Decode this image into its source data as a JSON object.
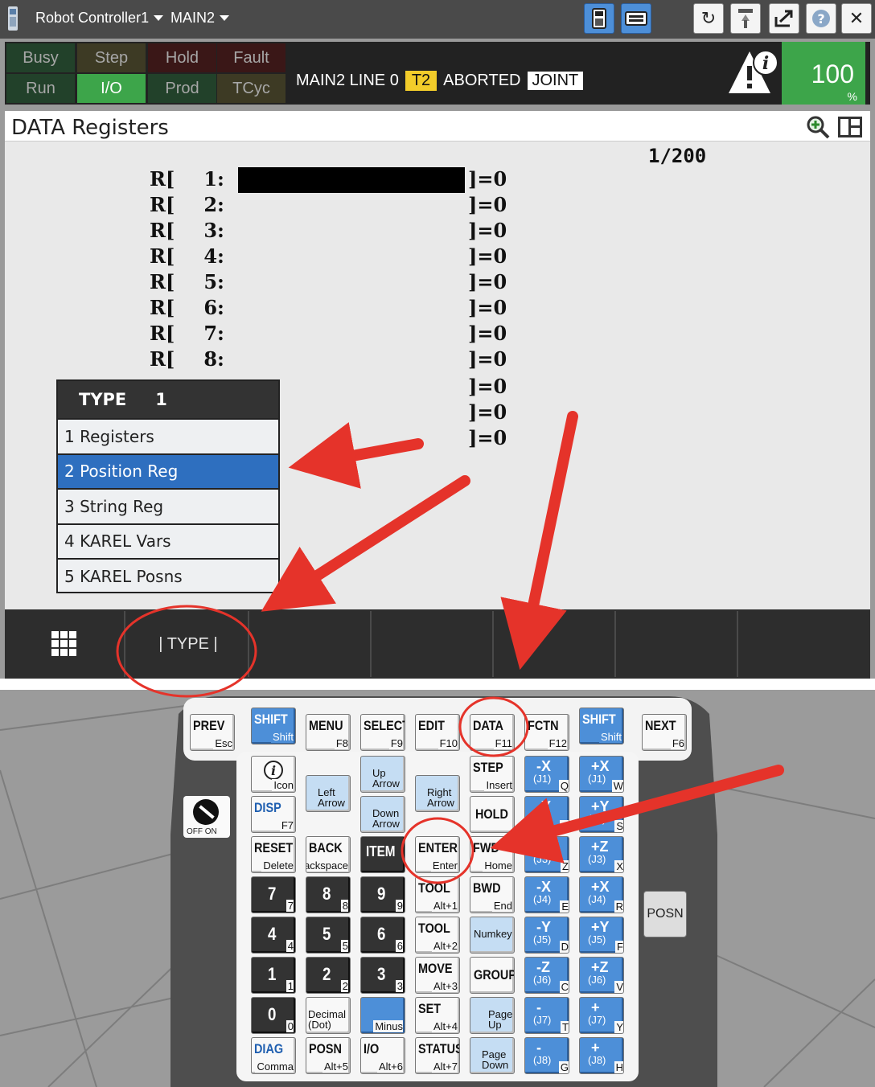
{
  "titlebar": {
    "controller": "Robot Controller1",
    "program": "MAIN2"
  },
  "status": {
    "buttons": [
      {
        "label": "Busy",
        "state": "off",
        "color": "#22412a"
      },
      {
        "label": "Step",
        "state": "off",
        "color": "#3d3a24"
      },
      {
        "label": "Hold",
        "state": "off",
        "color": "#3a1717"
      },
      {
        "label": "Fault",
        "state": "off",
        "color": "#3a1717"
      },
      {
        "label": "Run",
        "state": "off",
        "color": "#22412a"
      },
      {
        "label": "I/O",
        "state": "on",
        "color": "#3da54a"
      },
      {
        "label": "Prod",
        "state": "off",
        "color": "#22412a"
      },
      {
        "label": "TCyc",
        "state": "off",
        "color": "#3d3a24"
      }
    ],
    "line_text": "MAIN2 LINE 0",
    "mode_tag": "T2",
    "state_text": "ABORTED",
    "coord_tag": "JOINT",
    "override": "100",
    "override_unit": "%"
  },
  "screen": {
    "title": "DATA Registers",
    "page_indicator": "1/200",
    "registers": [
      {
        "prefix": "R[",
        "index": "1:",
        "value": "]=0"
      },
      {
        "prefix": "R[",
        "index": "2:",
        "value": "]=0"
      },
      {
        "prefix": "R[",
        "index": "3:",
        "value": "]=0"
      },
      {
        "prefix": "R[",
        "index": "4:",
        "value": "]=0"
      },
      {
        "prefix": "R[",
        "index": "5:",
        "value": "]=0"
      },
      {
        "prefix": "R[",
        "index": "6:",
        "value": "]=0"
      },
      {
        "prefix": "R[",
        "index": "7:",
        "value": "]=0"
      },
      {
        "prefix": "R[",
        "index": "8:",
        "value": "]=0"
      }
    ],
    "hidden_values": [
      "]=0",
      "]=0",
      "]=0"
    ]
  },
  "popup": {
    "title": "TYPE",
    "title_num": "1",
    "items": [
      {
        "label": "1 Registers",
        "selected": false
      },
      {
        "label": "2 Position Reg",
        "selected": true
      },
      {
        "label": "3 String Reg",
        "selected": false
      },
      {
        "label": "4 KAREL Vars",
        "selected": false
      },
      {
        "label": "5 KAREL Posns",
        "selected": false
      }
    ]
  },
  "fkeys": [
    "",
    "| TYPE |",
    "",
    "",
    "",
    "",
    ""
  ],
  "keypad": {
    "top_row": [
      {
        "main": "PREV",
        "sub": "Esc"
      },
      {
        "main": "SHIFT",
        "sub": "Shift",
        "blue": true
      },
      {
        "main": "MENU",
        "sub": "F8"
      },
      {
        "main": "SELECT",
        "sub": "F9"
      },
      {
        "main": "EDIT",
        "sub": "F10"
      },
      {
        "main": "DATA",
        "sub": "F11"
      },
      {
        "main": "FCTN",
        "sub": "F12"
      },
      {
        "main": "SHIFT",
        "sub": "Shift",
        "blue": true
      },
      {
        "main": "NEXT",
        "sub": "F6"
      }
    ],
    "labels": {
      "icon": "Icon",
      "disp": "DISP",
      "disp_sub": "F7",
      "up": "Up\nArrow",
      "left": "Left\nArrow",
      "right": "Right\nArrow",
      "down": "Down\nArrow",
      "step": "STEP",
      "step_sub": "Insert",
      "hold": "HOLD",
      "reset": "RESET",
      "reset_sub": "Delete",
      "back": "BACK",
      "back_sub": "Backspace",
      "item": "ITEM",
      "enter": "ENTER",
      "enter_sub": "Enter",
      "fwd": "FWD",
      "fwd_sub": "Home",
      "bwd": "BWD",
      "bwd_sub": "End",
      "tool1": "TOOL",
      "tool1_sub": "Alt+1",
      "tool2": "TOOL",
      "tool2_sub": "Alt+2",
      "move": "MOVE",
      "move_sub": "Alt+3",
      "setup": "SET",
      "setup_sub": "Alt+4",
      "numkey": "Numkey",
      "group": "GROUP",
      "pageup": "Page\nUp",
      "pagedown": "Page\nDown",
      "decimal": "Decimal\n(Dot)",
      "minus": "Minus",
      "diag": "DIAG",
      "diag_sub": "Comma",
      "posn": "POSN",
      "posn_sub": "Alt+5",
      "io": "I/O",
      "io_sub": "Alt+6",
      "status": "STATUS",
      "status_sub": "Alt+7",
      "posn_side": "POSN",
      "switch": "OFF  ON"
    },
    "digits": [
      {
        "main": "7",
        "sub": "7"
      },
      {
        "main": "8",
        "sub": "8"
      },
      {
        "main": "9",
        "sub": "9"
      },
      {
        "main": "4",
        "sub": "4"
      },
      {
        "main": "5",
        "sub": "5"
      },
      {
        "main": "6",
        "sub": "6"
      },
      {
        "main": "1",
        "sub": "1"
      },
      {
        "main": "2",
        "sub": "2"
      },
      {
        "main": "3",
        "sub": "3"
      },
      {
        "main": "0",
        "sub": "0"
      }
    ],
    "axes": [
      {
        "main": "-X",
        "main2": "(J1)",
        "sub": "Q"
      },
      {
        "main": "+X",
        "main2": "(J1)",
        "sub": "W"
      },
      {
        "main": "-Y",
        "main2": "(J2)",
        "sub": "A"
      },
      {
        "main": "+Y",
        "main2": "(J2)",
        "sub": "S"
      },
      {
        "main": "-Z",
        "main2": "(J3)",
        "sub": "Z"
      },
      {
        "main": "+Z",
        "main2": "(J3)",
        "sub": "X"
      },
      {
        "main": "-X",
        "main2": "(J4)",
        "sub": "E"
      },
      {
        "main": "+X",
        "main2": "(J4)",
        "sub": "R"
      },
      {
        "main": "-Y",
        "main2": "(J5)",
        "sub": "D"
      },
      {
        "main": "+Y",
        "main2": "(J5)",
        "sub": "F"
      },
      {
        "main": "-Z",
        "main2": "(J6)",
        "sub": "C"
      },
      {
        "main": "+Z",
        "main2": "(J6)",
        "sub": "V"
      },
      {
        "main": "-",
        "main2": "(J7)",
        "sub": "T"
      },
      {
        "main": "+",
        "main2": "(J7)",
        "sub": "Y"
      },
      {
        "main": "-",
        "main2": "(J8)",
        "sub": "G"
      },
      {
        "main": "+",
        "main2": "(J8)",
        "sub": "H"
      }
    ]
  },
  "colors": {
    "arrow": "#e5332a",
    "accent_blue": "#4d8fd8",
    "status_green": "#3da54a",
    "tag_yellow": "#f2cc2a"
  }
}
